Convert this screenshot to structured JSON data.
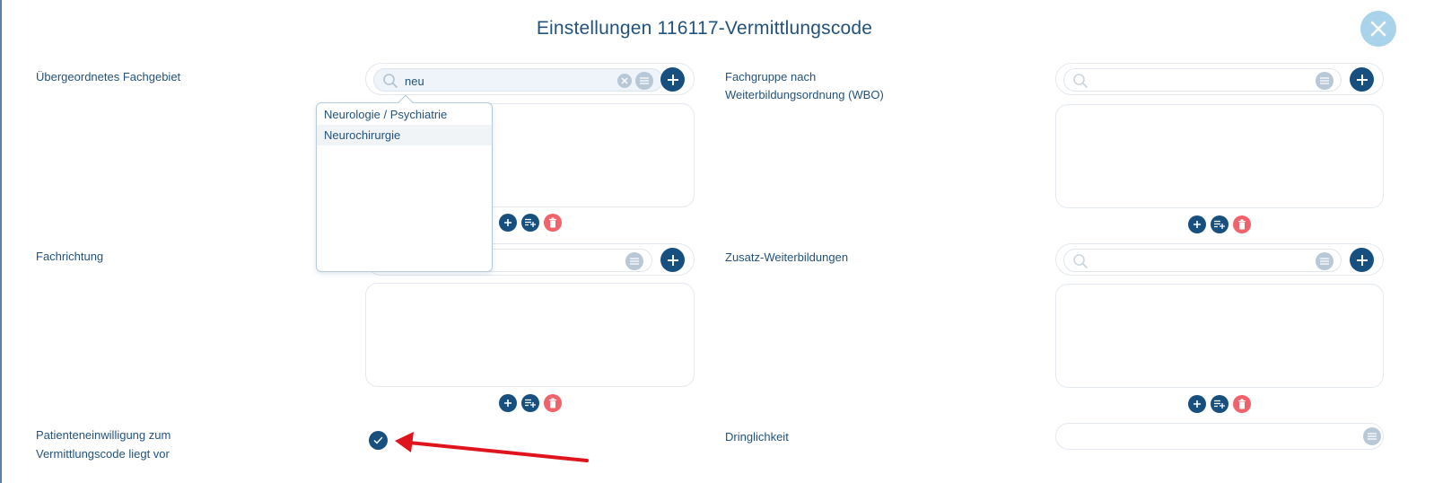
{
  "dialog": {
    "title": "Einstellungen 116117-Vermittlungscode",
    "close_icon": "close-icon"
  },
  "fields": {
    "fachgebiet": {
      "label": "Übergeordnetes Fachgebiet",
      "search_value": "neu",
      "search_placeholder": ""
    },
    "fachgruppe": {
      "label_line1": "Fachgruppe nach",
      "label_line2": "Weiterbildungsordnung (WBO)",
      "search_value": "",
      "search_placeholder": ""
    },
    "fachrichtung": {
      "label": "Fachrichtung",
      "search_value": "",
      "search_placeholder": ""
    },
    "zusatz": {
      "label": "Zusatz-Weiterbildungen",
      "search_value": "",
      "search_placeholder": ""
    },
    "patienteneinwilligung": {
      "label_line1": "Patienteneinwilligung zum",
      "label_line2": "Vermittlungscode liegt vor",
      "checked": true
    },
    "dringlichkeit": {
      "label": "Dringlichkeit",
      "value": ""
    }
  },
  "dropdown": {
    "items": [
      "Neurologie / Psychiatrie",
      "Neurochirurgie"
    ],
    "highlighted_index": 1
  },
  "colors": {
    "primary": "#17507f",
    "text": "#23537d",
    "danger": "#f0636b",
    "muted": "#b9c8d6",
    "annotation": "#e0141c"
  }
}
